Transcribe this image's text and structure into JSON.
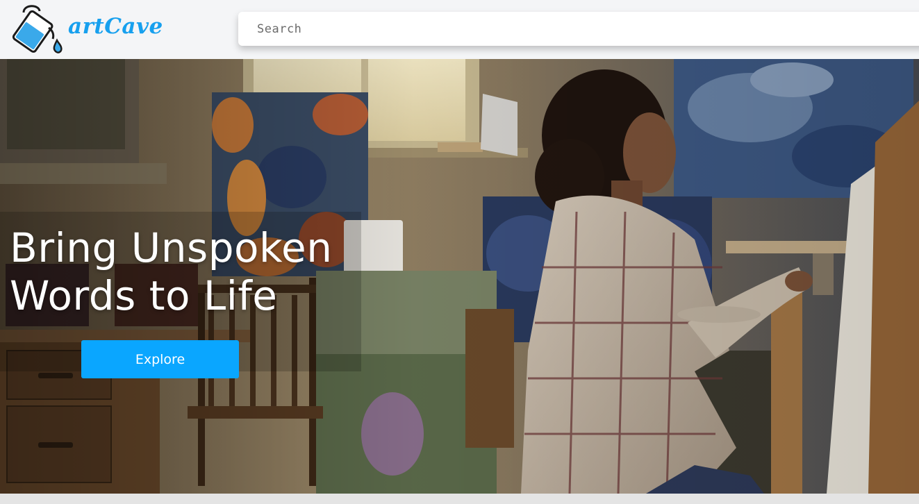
{
  "brand": {
    "name": "artCave",
    "icon": "paint-bucket-icon",
    "color": "#17a0ee"
  },
  "search": {
    "placeholder": "Search",
    "value": ""
  },
  "hero": {
    "title": "Bring Unspoken Words to Life",
    "cta_label": "Explore",
    "cta_color": "#0aa6ff",
    "image": "artist-painting-at-easel-photo"
  }
}
